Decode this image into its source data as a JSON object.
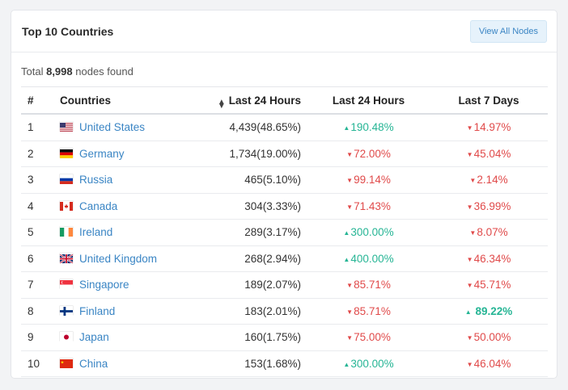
{
  "card": {
    "title": "Top 10 Countries",
    "view_all_label": "View All Nodes"
  },
  "summary": {
    "prefix": "Total",
    "count": "8,998",
    "suffix": "nodes found"
  },
  "table": {
    "headers": {
      "rank": "#",
      "country": "Countries",
      "nodes": "Last 24 Hours",
      "change_24h": "Last 24 Hours",
      "change_7d": "Last 7 Days"
    },
    "rows": [
      {
        "rank": "1",
        "country": "United States",
        "flag": "us",
        "nodes": "4,439(48.65%)",
        "d1": "190.48%",
        "d1_dir": "up",
        "d7": "14.97%",
        "d7_dir": "down"
      },
      {
        "rank": "2",
        "country": "Germany",
        "flag": "de",
        "nodes": "1,734(19.00%)",
        "d1": "72.00%",
        "d1_dir": "down",
        "d7": "45.04%",
        "d7_dir": "down"
      },
      {
        "rank": "3",
        "country": "Russia",
        "flag": "ru",
        "nodes": "465(5.10%)",
        "d1": "99.14%",
        "d1_dir": "down",
        "d7": "2.14%",
        "d7_dir": "down"
      },
      {
        "rank": "4",
        "country": "Canada",
        "flag": "ca",
        "nodes": "304(3.33%)",
        "d1": "71.43%",
        "d1_dir": "down",
        "d7": "36.99%",
        "d7_dir": "down"
      },
      {
        "rank": "5",
        "country": "Ireland",
        "flag": "ie",
        "nodes": "289(3.17%)",
        "d1": "300.00%",
        "d1_dir": "up",
        "d7": "8.07%",
        "d7_dir": "down"
      },
      {
        "rank": "6",
        "country": "United Kingdom",
        "flag": "gb",
        "nodes": "268(2.94%)",
        "d1": "400.00%",
        "d1_dir": "up",
        "d7": "46.34%",
        "d7_dir": "down"
      },
      {
        "rank": "7",
        "country": "Singapore",
        "flag": "sg",
        "nodes": "189(2.07%)",
        "d1": "85.71%",
        "d1_dir": "down",
        "d7": "45.71%",
        "d7_dir": "down"
      },
      {
        "rank": "8",
        "country": "Finland",
        "flag": "fi",
        "nodes": "183(2.01%)",
        "d1": "85.71%",
        "d1_dir": "down",
        "d7": "89.22%",
        "d7_dir": "up"
      },
      {
        "rank": "9",
        "country": "Japan",
        "flag": "jp",
        "nodes": "160(1.75%)",
        "d1": "75.00%",
        "d1_dir": "down",
        "d7": "50.00%",
        "d7_dir": "down"
      },
      {
        "rank": "10",
        "country": "China",
        "flag": "cn",
        "nodes": "153(1.68%)",
        "d1": "300.00%",
        "d1_dir": "up",
        "d7": "46.04%",
        "d7_dir": "down"
      }
    ]
  },
  "colors": {
    "up": "#26b595",
    "down": "#e04a4a",
    "link": "#3a85c4"
  }
}
